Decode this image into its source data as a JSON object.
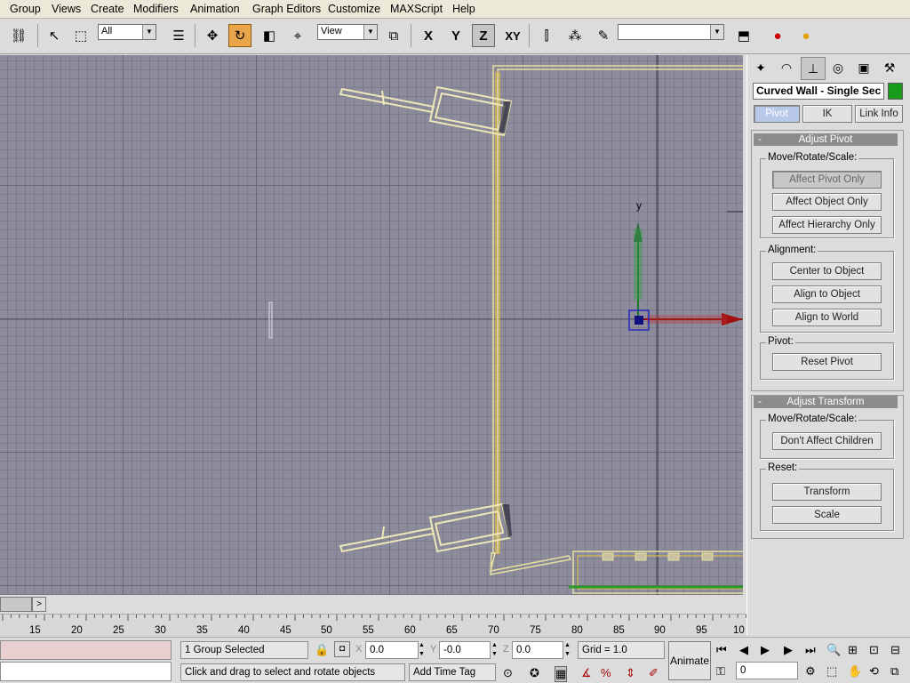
{
  "menu": [
    "Group",
    "Views",
    "Create",
    "Modifiers",
    "Animation",
    "Graph Editors",
    "Customize",
    "MAXScript",
    "Help"
  ],
  "toolbar": {
    "selection_filter": "All",
    "reference_coord": "View",
    "axis_x": "X",
    "axis_y": "Y",
    "axis_z": "Z",
    "axis_xy": "XY",
    "named_selection": ""
  },
  "viewport": {
    "axis_y_label": "y"
  },
  "panel": {
    "object_name": "Curved Wall - Single Sec",
    "object_color": "#1a9a1a",
    "tabs": {
      "pivot": "Pivot",
      "ik": "IK",
      "link_info": "Link Info"
    },
    "adjust_pivot": {
      "title": "Adjust Pivot",
      "move_group": "Move/Rotate/Scale:",
      "affect_pivot_only": "Affect Pivot Only",
      "affect_object_only": "Affect Object Only",
      "affect_hierarchy_only": "Affect Hierarchy Only",
      "alignment_group": "Alignment:",
      "center_to_object": "Center to Object",
      "align_to_object": "Align to Object",
      "align_to_world": "Align to World",
      "pivot_group": "Pivot:",
      "reset_pivot": "Reset Pivot"
    },
    "adjust_transform": {
      "title": "Adjust Transform",
      "move_group": "Move/Rotate/Scale:",
      "dont_affect_children": "Don't Affect Children",
      "reset_group": "Reset:",
      "transform": "Transform",
      "scale": "Scale"
    },
    "rollout_minus": "-"
  },
  "timeline": {
    "ticks": [
      "15",
      "20",
      "25",
      "30",
      "35",
      "40",
      "45",
      "50",
      "55",
      "60",
      "65",
      "70",
      "75",
      "80",
      "85",
      "90",
      "95",
      "10"
    ],
    "scroll_arrow": ">"
  },
  "status": {
    "selection": "1 Group Selected",
    "prompt": "Click and drag to select and rotate objects",
    "x_label": "X",
    "x_value": "0.0",
    "y_label": "Y",
    "y_value": "-0.0",
    "z_label": "Z",
    "z_value": "0.0",
    "grid": "Grid = 1.0",
    "add_time_tag": "Add Time Tag",
    "animate": "Animate",
    "frame": "0"
  }
}
